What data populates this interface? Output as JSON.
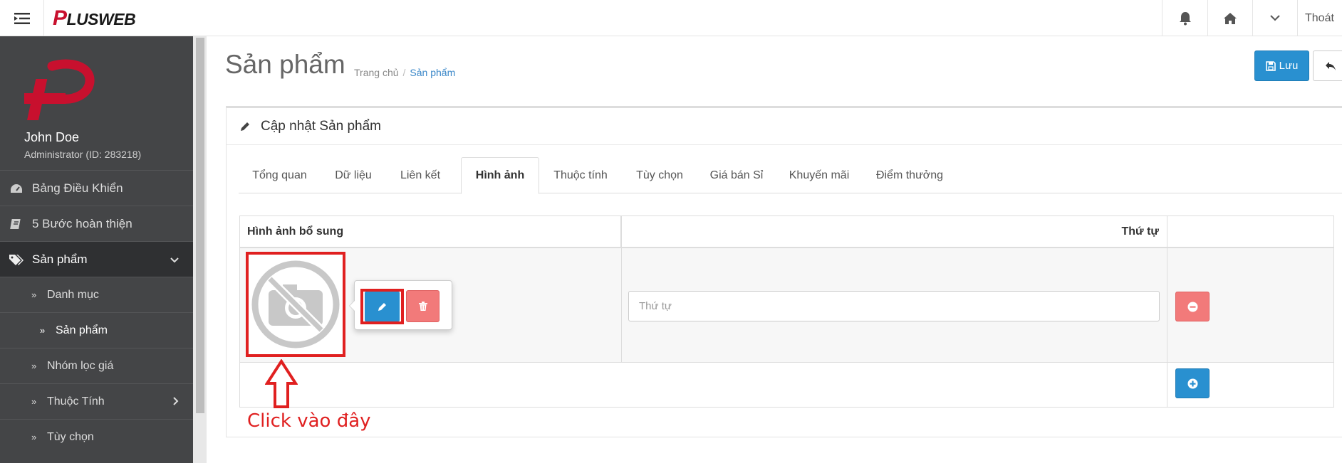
{
  "topbar": {
    "logo_p": "P",
    "logo_text": "LUSWEB",
    "exit_label": "Thoát"
  },
  "sidebar": {
    "user_name": "John Doe",
    "user_role": "Administrator (ID: 283218)",
    "items": [
      {
        "label": "Bảng Điều Khiển",
        "icon": "dashboard-icon"
      },
      {
        "label": "5 Bước hoàn thiện",
        "icon": "book-icon"
      },
      {
        "label": "Sản phẩm",
        "icon": "tags-icon"
      },
      {
        "label": "Danh mục"
      },
      {
        "label": "Sản phẩm"
      },
      {
        "label": "Nhóm lọc giá"
      },
      {
        "label": "Thuộc Tính"
      },
      {
        "label": "Tùy chọn"
      }
    ]
  },
  "header": {
    "title": "Sản phẩm",
    "breadcrumb_home": "Trang chủ",
    "breadcrumb_sep": "/",
    "breadcrumb_current": "Sản phẩm",
    "save_label": "Lưu"
  },
  "panel": {
    "title": "Cập nhật Sản phẩm",
    "tabs": [
      "Tổng quan",
      "Dữ liệu",
      "Liên kết",
      "Hình ảnh",
      "Thuộc tính",
      "Tùy chọn",
      "Giá bán Sỉ",
      "Khuyến mãi",
      "Điểm thưởng"
    ],
    "active_tab": "Hình ảnh"
  },
  "table": {
    "col_image": "Hình ảnh bổ sung",
    "col_order": "Thứ tự",
    "order_placeholder": "Thứ tự"
  },
  "annotation": {
    "text": "Click vào đây",
    "color": "#e02020"
  },
  "colors": {
    "primary": "#2990d0",
    "danger": "#f27a7a",
    "sidebar": "#444547",
    "brand_red": "#c8102e"
  }
}
